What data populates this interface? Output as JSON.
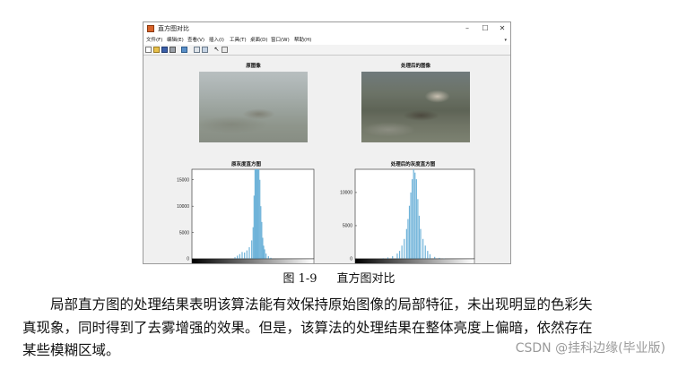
{
  "window": {
    "title": "直方图对比",
    "controls": {
      "minimize": "–",
      "maximize": "☐",
      "close": "✕"
    }
  },
  "menubar": {
    "items": [
      "文件(F)",
      "编辑(E)",
      "查看(V)",
      "插入(I)",
      "工具(T)",
      "桌面(D)",
      "窗口(W)",
      "帮助(H)"
    ],
    "overflow": "▾"
  },
  "toolbar": {
    "icons": [
      "new-figure-icon",
      "open-file-icon",
      "save-icon",
      "print-icon",
      "export-icon",
      "link-plot-icon",
      "insert-colorbar-icon",
      "pointer-icon",
      "data-cursor-icon"
    ]
  },
  "figure": {
    "image_left_title": "原图像",
    "image_right_title": "处理后的图像"
  },
  "chart_data": [
    {
      "type": "bar",
      "title": "原灰度直方图",
      "xlim": [
        0,
        255
      ],
      "ylim": [
        0,
        17000
      ],
      "x_ticks": [
        "0",
        "50",
        "100",
        "150",
        "200",
        "250"
      ],
      "y_ticks": [
        "0",
        "5000",
        "10000",
        "15000"
      ],
      "x": [
        90,
        95,
        100,
        105,
        110,
        115,
        120,
        125,
        128,
        130,
        132,
        134,
        136,
        138,
        140,
        142,
        144,
        146,
        148,
        150,
        152,
        155,
        160,
        165
      ],
      "values": [
        300,
        600,
        900,
        1300,
        1200,
        1600,
        2200,
        3500,
        6000,
        12000,
        17000,
        17000,
        17000,
        17000,
        17000,
        15000,
        10000,
        7000,
        4000,
        2500,
        1800,
        1000,
        500,
        200
      ],
      "colorbar": "grayscale",
      "bar_color": "#6fb3d9"
    },
    {
      "type": "bar",
      "title": "处理后的灰度直方图",
      "xlim": [
        0,
        255
      ],
      "ylim": [
        0,
        13500
      ],
      "x_ticks": [
        "0",
        "50",
        "100",
        "150",
        "200",
        "250"
      ],
      "y_ticks": [
        "0",
        "5000",
        "10000"
      ],
      "x": [
        60,
        70,
        80,
        90,
        95,
        100,
        105,
        110,
        113,
        116,
        119,
        122,
        125,
        128,
        131,
        134,
        137,
        140,
        145,
        150,
        155,
        160,
        170,
        180,
        190
      ],
      "values": [
        100,
        200,
        400,
        800,
        1200,
        2000,
        3000,
        4500,
        6000,
        8000,
        10000,
        12000,
        13500,
        13000,
        12000,
        9000,
        6500,
        4500,
        3000,
        2000,
        1200,
        700,
        300,
        150,
        60
      ],
      "colorbar": "grayscale",
      "bar_color": "#6fb3d9"
    }
  ],
  "caption": {
    "number": "图 1-9",
    "text": "直方图对比"
  },
  "paragraph": {
    "lines": [
      "局部直方图的处理结果表明该算法能有效保持原始图像的局部特征，未出现明显的色彩失",
      "真现象，同时得到了去雾增强的效果。但是，该算法的处理结果在整体亮度上偏暗，依然存在",
      "某些模糊区域。"
    ]
  },
  "watermark": "CSDN @挂科边缘(毕业版)"
}
